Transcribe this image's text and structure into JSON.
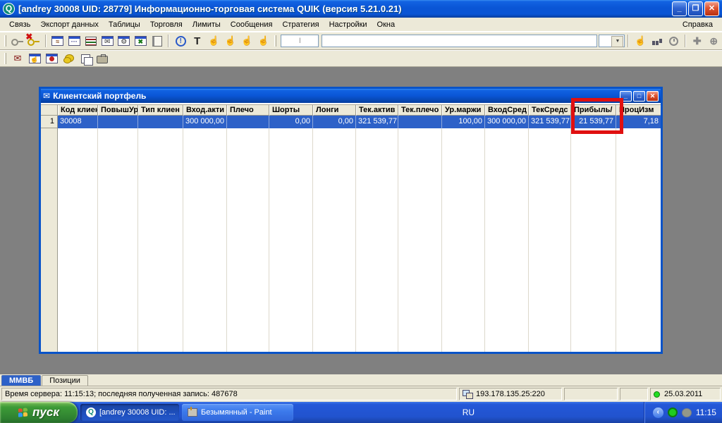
{
  "titlebar": {
    "title": "[andrey 30008  UID: 28779] Информационно-торговая система QUIK (версия 5.21.0.21)",
    "app_icon": "quik-q-logo",
    "buttons": [
      "minimize",
      "restore",
      "close"
    ]
  },
  "menubar": {
    "items": [
      "Связь",
      "Экспорт данных",
      "Таблицы",
      "Торговля",
      "Лимиты",
      "Сообщения",
      "Стратегия",
      "Настройки",
      "Окна"
    ],
    "help": "Справка"
  },
  "toolbar": {
    "row1_icons": [
      "connect-key-icon",
      "disconnect-key-icon",
      "chart-window-icon",
      "quotes-window-icon",
      "table-icon",
      "mail-window-icon",
      "settings-window-icon",
      "excel-export-icon",
      "notebook-icon",
      "alert-bubble-icon",
      "text-tool-icon",
      "order-hand-icon",
      "cancel-order-hand-icon",
      "hand-3-icon",
      "hand-4-icon",
      "hand-active-icon",
      "bar-chart-icon",
      "clock-icon",
      "move-icon",
      "target-icon"
    ],
    "row2_icons": [
      "mail-cancel-icon",
      "hand-window-icon",
      "stop-window-icon",
      "coins-icon",
      "copy-windows-icon",
      "briefcase-icon"
    ],
    "style_box_value": "I"
  },
  "portfolio": {
    "title": "Клиентский портфель",
    "columns": [
      "Код клиен",
      "ПовышУр",
      "Тип клиен",
      "Вход.акти",
      "Плечо",
      "Шорты",
      "Лонги",
      "Тек.актив",
      "Тек.плечо",
      "Ур.маржи",
      "ВходСред",
      "ТекСредс",
      "Прибыль/",
      "ПроцИзм"
    ],
    "row": {
      "num": "1",
      "cells": [
        "30008",
        "",
        "",
        "300 000,00",
        "",
        "0,00",
        "0,00",
        "321 539,77",
        "",
        "100,00",
        "300 000,00",
        "321 539,77",
        "21 539,77",
        "7,18"
      ]
    },
    "highlight": {
      "column": "Прибыль/",
      "value": "21 539,77",
      "color": "#E01010"
    }
  },
  "tabs": {
    "items": [
      "ММВБ",
      "Позиции"
    ],
    "active": "ММВБ"
  },
  "statusbar": {
    "server_info": "Время сервера: 11:15:13; последняя полученная запись: 487678",
    "ip": "193.178.135.25:220",
    "date": "25.03.2011"
  },
  "taskbar": {
    "start": "пуск",
    "tasks": [
      "[andrey 30008  UID: ...",
      "Безымянный - Paint"
    ],
    "lang": "RU",
    "time": "11:15"
  },
  "colors": {
    "title_blue": "#0A55D5",
    "selection_blue": "#2D61C8",
    "highlight_red": "#E01010",
    "desktop_gray": "#808080",
    "chrome_beige": "#ECE9D8",
    "start_green": "#3D9B37"
  }
}
